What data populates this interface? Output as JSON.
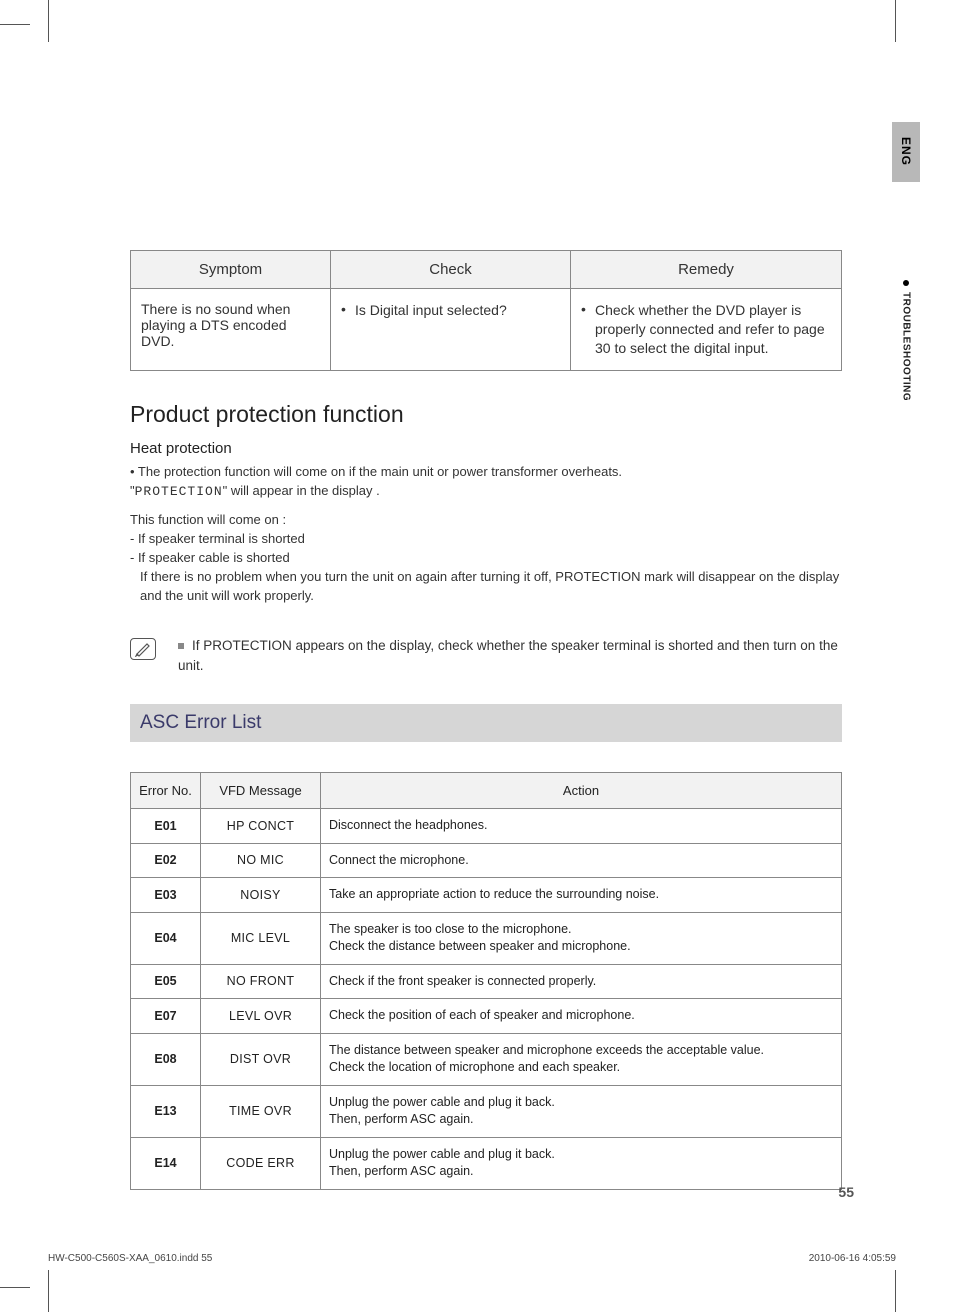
{
  "sidebar": {
    "lang": "ENG",
    "section": "TROUBLESHOOTING"
  },
  "troubleshoot_table": {
    "headers": {
      "symptom": "Symptom",
      "check": "Check",
      "remedy": "Remedy"
    },
    "row": {
      "symptom": "There is no sound when playing a DTS encoded DVD.",
      "check": "Is Digital input selected?",
      "remedy": "Check whether the DVD player is properly connected and refer to page 30 to select the digital input."
    }
  },
  "protection": {
    "title": "Product protection function",
    "subtitle": "Heat protection",
    "line1": "• The protection function will come on if the main unit or power transformer overheats.",
    "line2_prefix": "\"",
    "line2_mono": "PROTECTION",
    "line2_suffix": "\" will appear in the display .",
    "line3": "This function will come on :",
    "line4": "- If speaker terminal is shorted",
    "line5": "- If speaker cable is shorted",
    "line6": "  If there is no problem when you turn the unit on again after turning it off, PROTECTION mark will disappear on the display and the unit will work properly."
  },
  "note": "If PROTECTION appears on the display, check whether the speaker terminal is shorted and then turn on the unit.",
  "asc": {
    "title": "ASC Error List",
    "headers": {
      "err": "Error No.",
      "msg": "VFD Message",
      "act": "Action"
    },
    "rows": [
      {
        "err": "E01",
        "msg": "HP CONCT",
        "act": "Disconnect the headphones."
      },
      {
        "err": "E02",
        "msg": "NO MIC",
        "act": "Connect the microphone."
      },
      {
        "err": "E03",
        "msg": "NOISY",
        "act": "Take an appropriate action to reduce the surrounding noise."
      },
      {
        "err": "E04",
        "msg": "MIC LEVL",
        "act": "The speaker is too close to the microphone.\nCheck the distance between speaker and microphone."
      },
      {
        "err": "E05",
        "msg": "NO FRONT",
        "act": "Check if the front speaker is connected properly."
      },
      {
        "err": "E07",
        "msg": "LEVL OVR",
        "act": "Check the position of each of speaker and microphone."
      },
      {
        "err": "E08",
        "msg": "DIST OVR",
        "act": "The distance between speaker and microphone exceeds the acceptable value.\nCheck the location of microphone and each speaker."
      },
      {
        "err": "E13",
        "msg": "TIME OVR",
        "act": "Unplug the power cable and plug it back.\nThen, perform ASC again."
      },
      {
        "err": "E14",
        "msg": "CODE ERR",
        "act": "Unplug the power cable and plug it back.\nThen, perform ASC again."
      }
    ]
  },
  "page_number": "55",
  "footer": {
    "left": "HW-C500-C560S-XAA_0610.indd   55",
    "right": "2010-06-16    4:05:59"
  }
}
